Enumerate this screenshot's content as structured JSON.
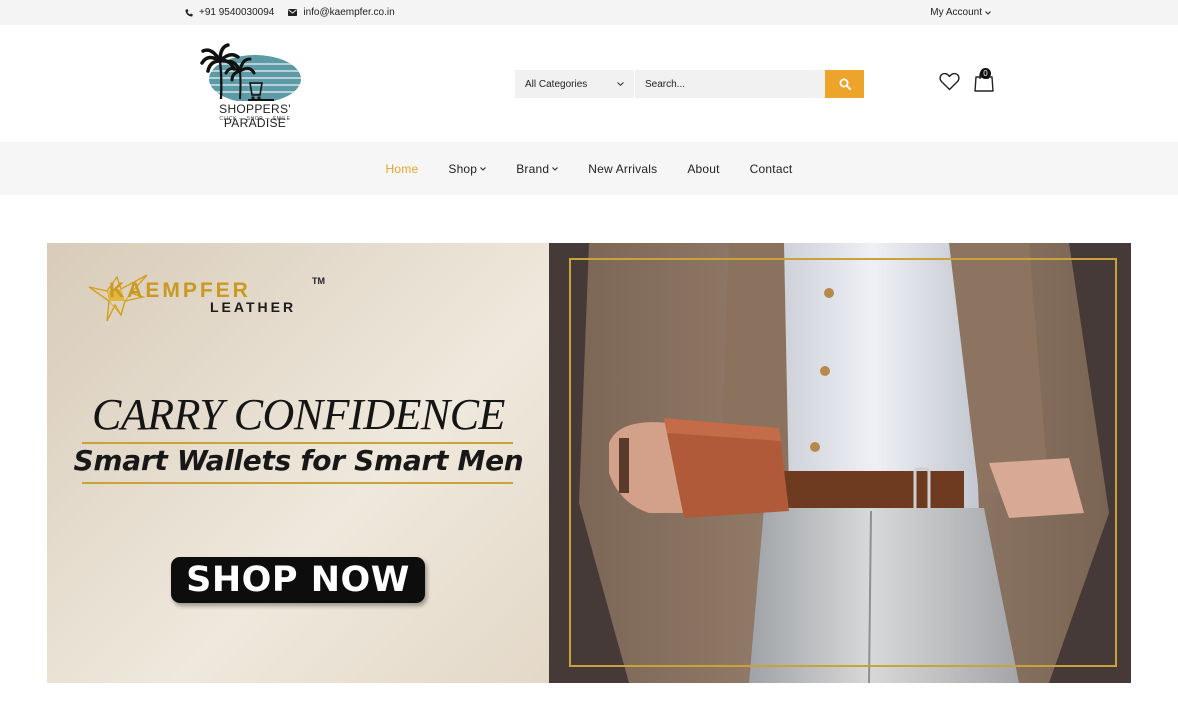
{
  "topbar": {
    "phone": "+91 9540030094",
    "email": "info@kaempfer.co.in",
    "account": "My Account"
  },
  "logo": {
    "name": "SHOPPERS' PARADISE",
    "tagline": "CLICK — SHOP — SMILE"
  },
  "search": {
    "category": "All Categories",
    "placeholder": "Search..."
  },
  "cart": {
    "count": "0"
  },
  "nav": {
    "items": [
      {
        "label": "Home"
      },
      {
        "label": "Shop"
      },
      {
        "label": "Brand"
      },
      {
        "label": "New Arrivals"
      },
      {
        "label": "About"
      },
      {
        "label": "Contact"
      }
    ]
  },
  "banner": {
    "brand": "KAEMPFER",
    "brand_tm": "TM",
    "brand_sub": "LEATHER",
    "headline": "CARRY CONFIDENCE",
    "subheadline": "Smart Wallets for Smart Men",
    "cta": "SHOP NOW"
  },
  "colors": {
    "accent": "#eca42a",
    "gold": "#c9a23a"
  }
}
